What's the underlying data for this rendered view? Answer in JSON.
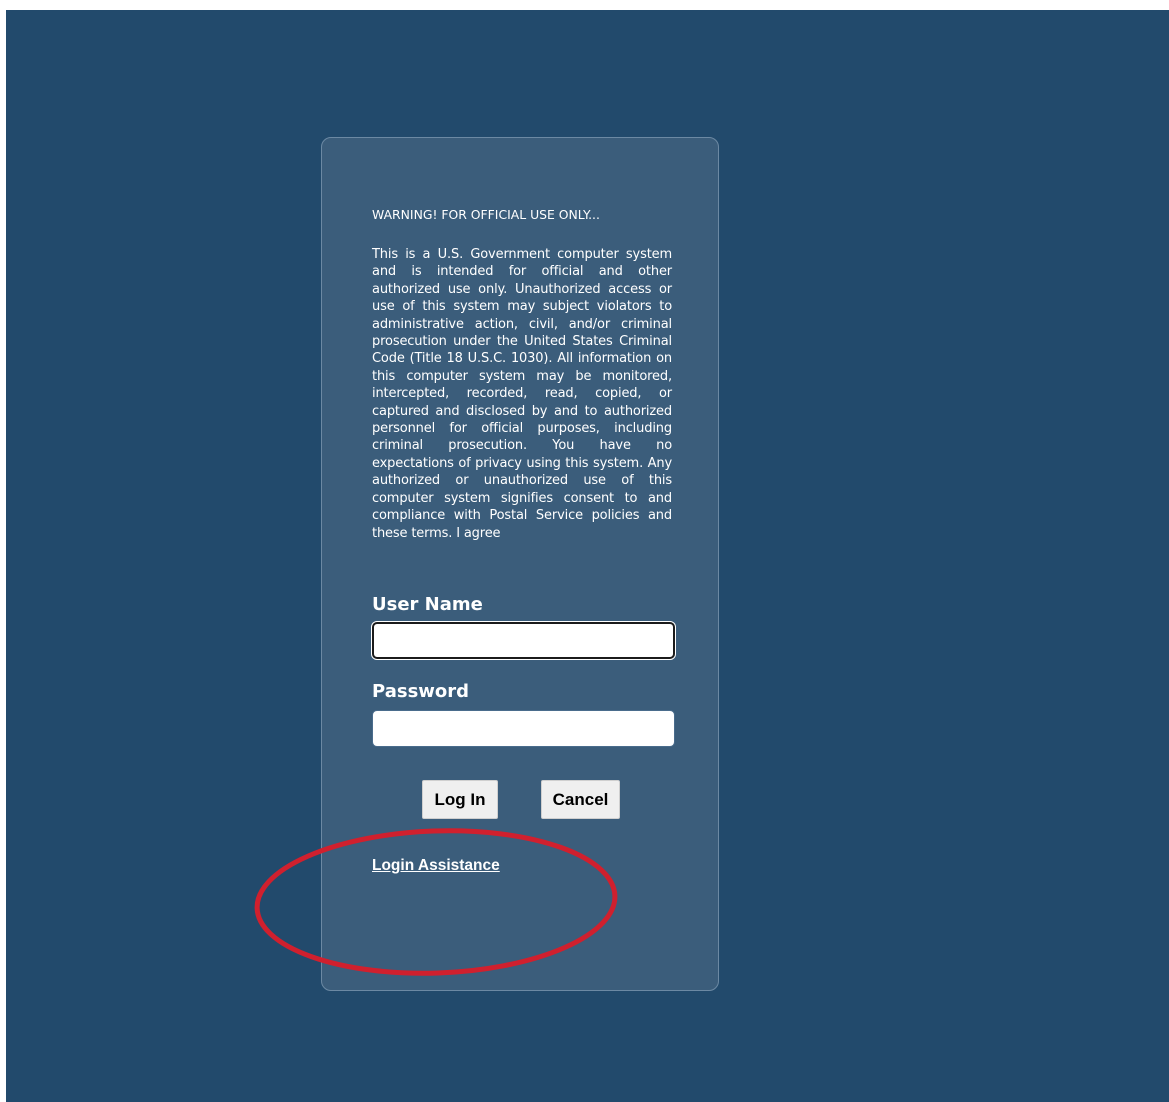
{
  "warning": {
    "title": "WARNING! FOR OFFICIAL USE ONLY...",
    "body": "This is a U.S. Government computer system and is intended for official and other authorized use only. Unauthorized access or use of this system may subject violators to administrative action, civil, and/or criminal prosecution under the United States Criminal Code (Title 18 U.S.C. 1030). All information on this computer system may be monitored, intercepted, recorded, read, copied, or captured and disclosed by and to authorized personnel for official purposes, including criminal prosecution. You have no expectations of privacy using this system. Any authorized or unauthorized use of this computer system signifies consent to and compliance with Postal Service policies and these terms. I agree"
  },
  "form": {
    "username_label": "User Name",
    "username_value": "",
    "password_label": "Password",
    "password_value": "",
    "login_button": "Log In",
    "cancel_button": "Cancel"
  },
  "links": {
    "login_assistance": "Login Assistance"
  },
  "colors": {
    "background": "#224a6c",
    "panel": "#3b5d7b",
    "annotation": "#d0202e"
  }
}
